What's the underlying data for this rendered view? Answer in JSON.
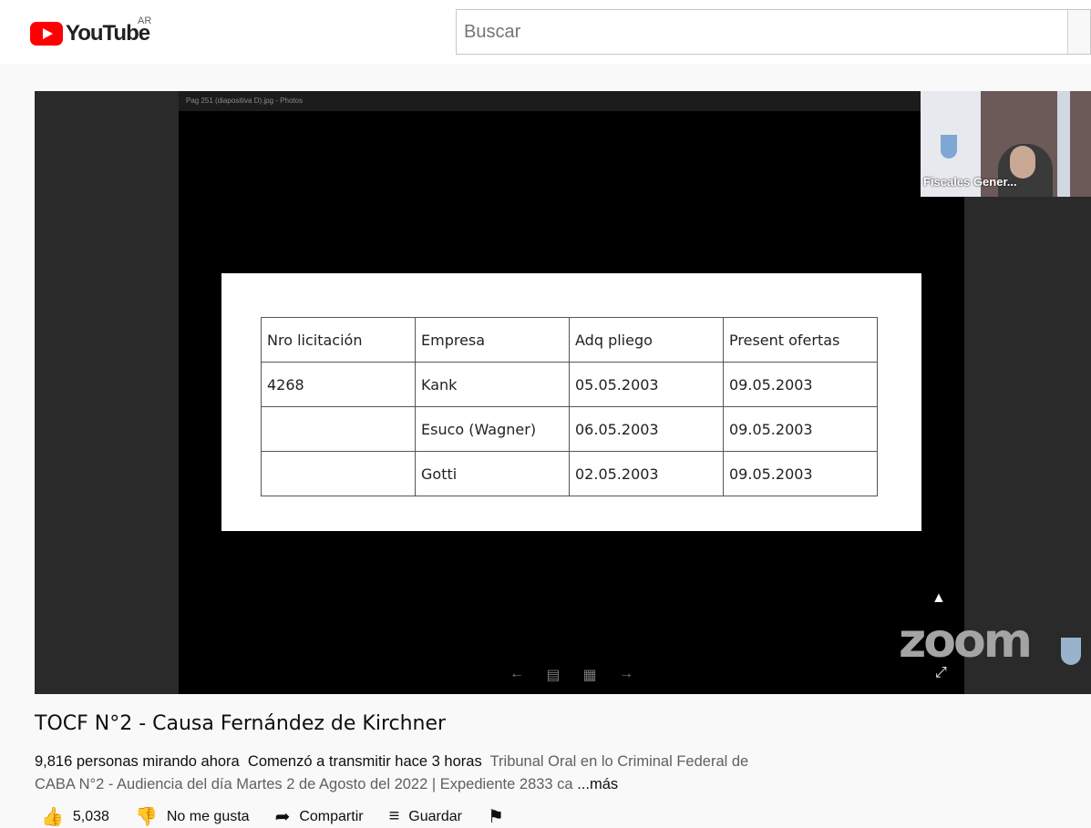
{
  "header": {
    "logo_text": "YouTube",
    "region": "AR",
    "search_placeholder": "Buscar"
  },
  "player": {
    "photos_bar": "Pag 251 (diapositiva D).jpg - Photos",
    "table": {
      "headers": [
        "Nro licitación",
        "Empresa",
        "Adq pliego",
        "Present ofertas"
      ],
      "rows": [
        [
          "4268",
          "Kank",
          "05.05.2003",
          "09.05.2003"
        ],
        [
          "",
          "Esuco (Wagner)",
          "06.05.2003",
          "09.05.2003"
        ],
        [
          "",
          "Gotti",
          "02.05.2003",
          "09.05.2003"
        ]
      ]
    },
    "webcam_label": "Fiscales Gener...",
    "zoom_logo": "zoom"
  },
  "video": {
    "title": "TOCF N°2 - Causa Fernández de Kirchner",
    "watching": "9,816 personas mirando ahora",
    "started": "Comenzó a transmitir hace 3 horas",
    "description": "Tribunal Oral en lo Criminal Federal de CABA N°2 - Audiencia del día Martes 2 de Agosto del 2022 | Expediente 2833 ca",
    "more": "...más"
  },
  "actions": {
    "likes": "5,038",
    "dislike": "No me gusta",
    "share": "Compartir",
    "save": "Guardar"
  },
  "colors": {
    "brand": "#ff0000"
  }
}
